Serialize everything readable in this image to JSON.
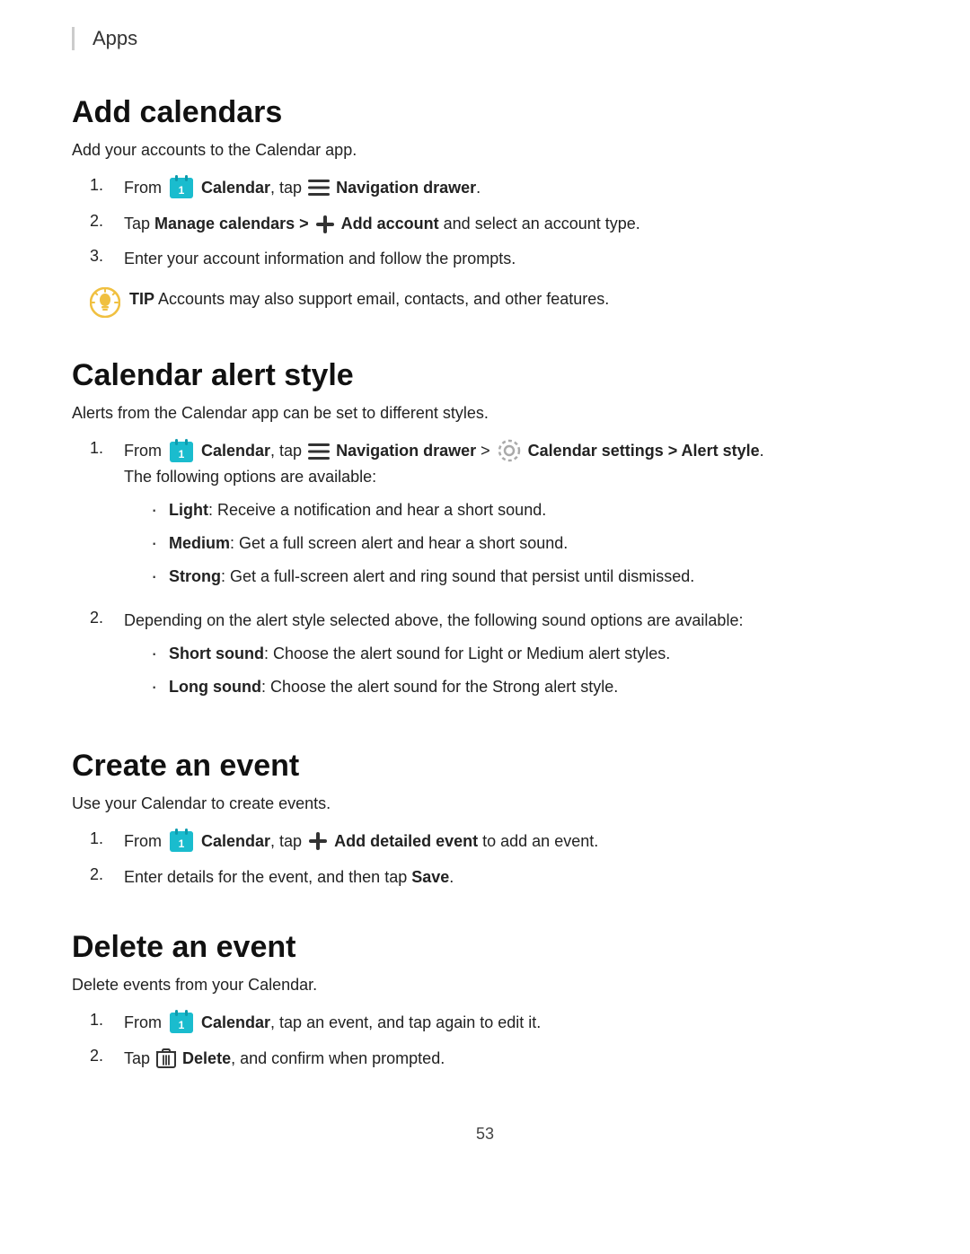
{
  "header": {
    "title": "Apps"
  },
  "sections": [
    {
      "id": "add-calendars",
      "title": "Add calendars",
      "intro": "Add your accounts to the Calendar app.",
      "steps": [
        {
          "number": "1.",
          "parts": [
            {
              "type": "text",
              "content": "From "
            },
            {
              "type": "calendar-icon"
            },
            {
              "type": "bold",
              "content": "Calendar"
            },
            {
              "type": "text",
              "content": ", tap "
            },
            {
              "type": "nav-icon"
            },
            {
              "type": "bold",
              "content": "Navigation drawer"
            },
            {
              "type": "text",
              "content": "."
            }
          ]
        },
        {
          "number": "2.",
          "parts": [
            {
              "type": "text",
              "content": "Tap "
            },
            {
              "type": "bold",
              "content": "Manage calendars > "
            },
            {
              "type": "plus-inline"
            },
            {
              "type": "bold",
              "content": " Add account"
            },
            {
              "type": "text",
              "content": " and select an account type."
            }
          ]
        },
        {
          "number": "3.",
          "parts": [
            {
              "type": "text",
              "content": "Enter your account information and follow the prompts."
            }
          ]
        }
      ],
      "tip": "Accounts may also support email, contacts, and other features."
    },
    {
      "id": "calendar-alert-style",
      "title": "Calendar alert style",
      "intro": "Alerts from the Calendar app can be set to different styles.",
      "steps": [
        {
          "number": "1.",
          "mainParts": [
            {
              "type": "text",
              "content": "From "
            },
            {
              "type": "calendar-icon"
            },
            {
              "type": "bold",
              "content": "Calendar"
            },
            {
              "type": "text",
              "content": ", tap "
            },
            {
              "type": "nav-icon"
            },
            {
              "type": "bold",
              "content": "Navigation drawer"
            },
            {
              "type": "text",
              "content": " > "
            },
            {
              "type": "gear-icon"
            },
            {
              "type": "bold",
              "content": "Calendar settings"
            },
            {
              "type": "bold",
              "content": " > Alert style"
            },
            {
              "type": "text",
              "content": "."
            }
          ],
          "subText": "The following options are available:",
          "bullets": [
            {
              "bold": "Light",
              "text": ": Receive a notification and hear a short sound."
            },
            {
              "bold": "Medium",
              "text": ": Get a full screen alert and hear a short sound."
            },
            {
              "bold": "Strong",
              "text": ": Get a full-screen alert and ring sound that persist until dismissed."
            }
          ]
        },
        {
          "number": "2.",
          "mainParts": [
            {
              "type": "text",
              "content": "Depending on the alert style selected above, the following sound options are available:"
            }
          ],
          "bullets": [
            {
              "bold": "Short sound",
              "text": ": Choose the alert sound for Light or Medium alert styles."
            },
            {
              "bold": "Long sound",
              "text": ": Choose the alert sound for the Strong alert style."
            }
          ]
        }
      ]
    },
    {
      "id": "create-an-event",
      "title": "Create an event",
      "intro": "Use your Calendar to create events.",
      "steps": [
        {
          "number": "1.",
          "parts": [
            {
              "type": "text",
              "content": "From "
            },
            {
              "type": "calendar-icon"
            },
            {
              "type": "bold",
              "content": "Calendar"
            },
            {
              "type": "text",
              "content": ", tap "
            },
            {
              "type": "plus-icon"
            },
            {
              "type": "bold",
              "content": "Add detailed event"
            },
            {
              "type": "text",
              "content": " to add an event."
            }
          ]
        },
        {
          "number": "2.",
          "parts": [
            {
              "type": "text",
              "content": "Enter details for the event, and then tap "
            },
            {
              "type": "bold",
              "content": "Save"
            },
            {
              "type": "text",
              "content": "."
            }
          ]
        }
      ]
    },
    {
      "id": "delete-an-event",
      "title": "Delete an event",
      "intro": "Delete events from your Calendar.",
      "steps": [
        {
          "number": "1.",
          "parts": [
            {
              "type": "text",
              "content": "From "
            },
            {
              "type": "calendar-icon"
            },
            {
              "type": "bold",
              "content": "Calendar"
            },
            {
              "type": "text",
              "content": ", tap an event, and tap again to edit it."
            }
          ]
        },
        {
          "number": "2.",
          "parts": [
            {
              "type": "text",
              "content": "Tap "
            },
            {
              "type": "trash-icon"
            },
            {
              "type": "bold",
              "content": "Delete"
            },
            {
              "type": "text",
              "content": ", and confirm when prompted."
            }
          ]
        }
      ]
    }
  ],
  "footer": {
    "page_number": "53"
  }
}
